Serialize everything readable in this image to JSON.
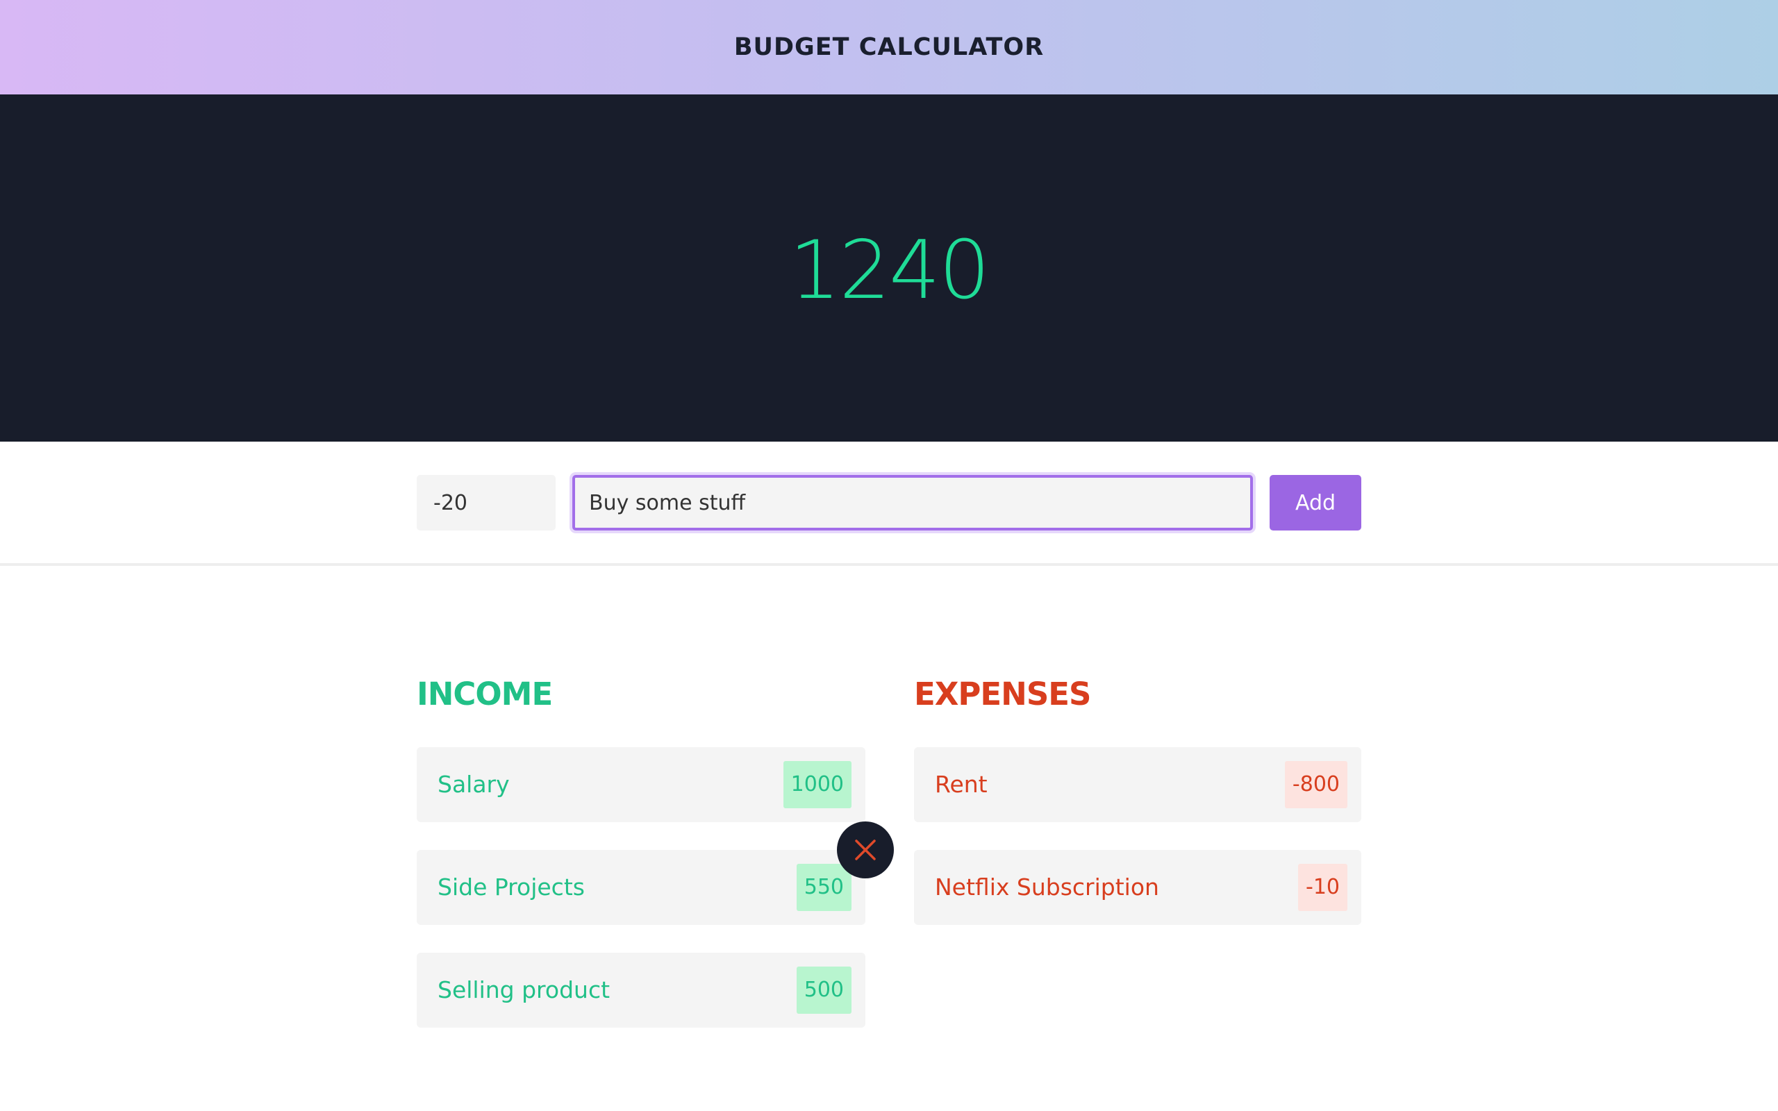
{
  "header": {
    "title": "BUDGET CALCULATOR"
  },
  "balance": {
    "value": "1240",
    "color": "#1fdc97"
  },
  "form": {
    "amount_value": "-20",
    "description_value": "Buy some stuff",
    "add_label": "Add"
  },
  "income": {
    "title": "INCOME",
    "color": "#21c087",
    "items": [
      {
        "label": "Salary",
        "value": "1000"
      },
      {
        "label": "Side Projects",
        "value": "550"
      },
      {
        "label": "Selling product",
        "value": "500"
      }
    ]
  },
  "expenses": {
    "title": "EXPENSES",
    "color": "#d83e1e",
    "items": [
      {
        "label": "Rent",
        "value": "-800"
      },
      {
        "label": "Netflix Subscription",
        "value": "-10"
      }
    ]
  },
  "delete_control": {
    "icon": "close-icon",
    "color": "#e04a2a"
  },
  "accent_color": "#9b66e3"
}
